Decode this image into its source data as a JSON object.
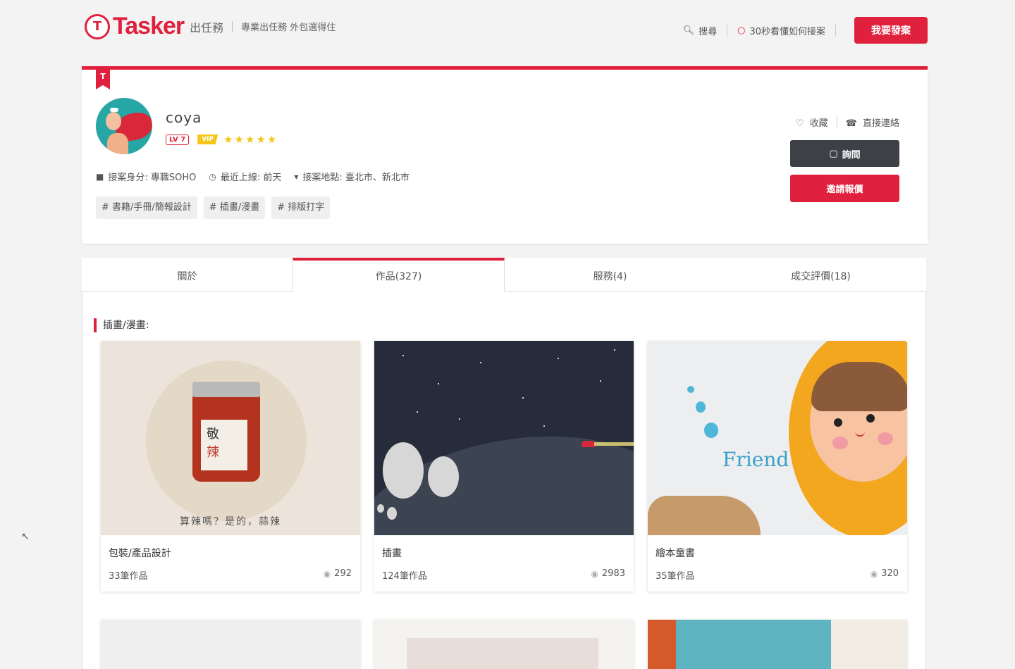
{
  "header": {
    "logo_word": "Tasker",
    "logo_cn": "出任務",
    "slogan": "專業出任務 外包選得住",
    "search_label": "搜尋",
    "tip_label": "30秒看懂如何接案",
    "post_button": "我要發案",
    "logo_mark": "T"
  },
  "profile": {
    "bookmark": "T",
    "username": "coya",
    "level": "LV 7",
    "vip": "VIP",
    "stars": "★★★★★",
    "rating": 5,
    "identity": "接案身分: 專職SOHO",
    "last_online": "最近上線: 前天",
    "location": "接案地點: 臺北市、新北市",
    "tags": [
      "# 書籍/手冊/簡報設計",
      "# 插畫/漫畫",
      "# 排版打字"
    ],
    "favorite_label": "收藏",
    "contact_label": "直接連絡",
    "ask_button": "詢問",
    "quote_button": "邀請報價"
  },
  "tabs": [
    {
      "label": "關於",
      "active": false
    },
    {
      "label": "作品(327)",
      "active": true
    },
    {
      "label": "服務(4)",
      "active": false
    },
    {
      "label": "成交評價(18)",
      "active": false
    }
  ],
  "section_title": "插畫/漫畫:",
  "portfolio": [
    {
      "title": "包裝/產品設計",
      "count": "33筆作品",
      "views": "292",
      "jar_text_1": "敬",
      "jar_text_2": "辣",
      "caption": "算辣嗎？是的，蒜辣"
    },
    {
      "title": "插畫",
      "count": "124筆作品",
      "views": "2983"
    },
    {
      "title": "繪本童書",
      "count": "35筆作品",
      "views": "320",
      "art_text": "Friend"
    }
  ],
  "icons": {
    "search": "search-icon",
    "bulb": "lightbulb-icon",
    "heart": "heart-icon",
    "phone": "phone-icon",
    "chat": "chat-icon",
    "user": "user-icon",
    "clock": "clock-icon",
    "pin": "map-pin-icon",
    "eye": "eye-icon"
  },
  "colors": {
    "brand": "#e0213d",
    "dark_button": "#3d4046",
    "star": "#f5c518"
  }
}
